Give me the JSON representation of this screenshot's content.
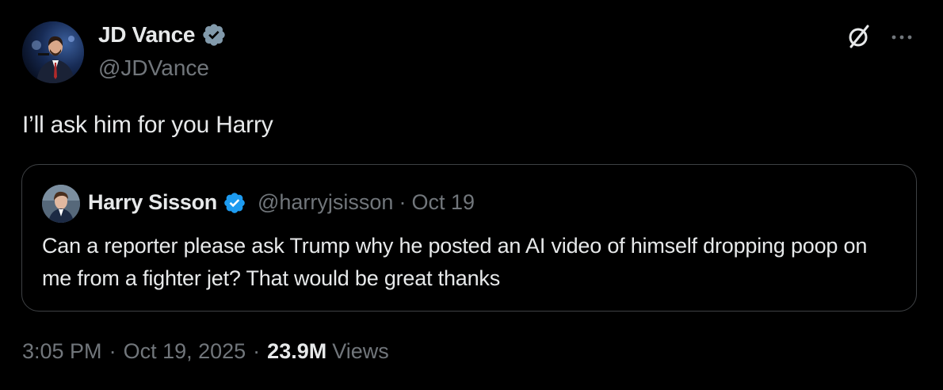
{
  "author": {
    "name": "JD Vance",
    "handle": "@JDVance",
    "verified": true,
    "verified_color": "#829aab"
  },
  "tweet": {
    "text": "I’ll ask him for you Harry"
  },
  "quote": {
    "name": "Harry Sisson",
    "handle": "@harryjsisson",
    "separator": "·",
    "date": "Oct 19",
    "verified": true,
    "verified_color": "#1d9bf0",
    "text": "Can a reporter please ask Trump why he posted an AI video of himself dropping poop on me from a fighter jet? That would be great thanks"
  },
  "meta": {
    "time": "3:05 PM",
    "separator": "·",
    "date": "Oct 19, 2025",
    "views_count": "23.9M",
    "views_label": "Views"
  },
  "icons": {
    "grok": "grok-icon",
    "more": "more-icon",
    "verified": "verified-badge-icon"
  },
  "colors": {
    "background": "#000000",
    "text_primary": "#e7e9ea",
    "text_secondary": "#71767b",
    "border": "#3e4144"
  }
}
